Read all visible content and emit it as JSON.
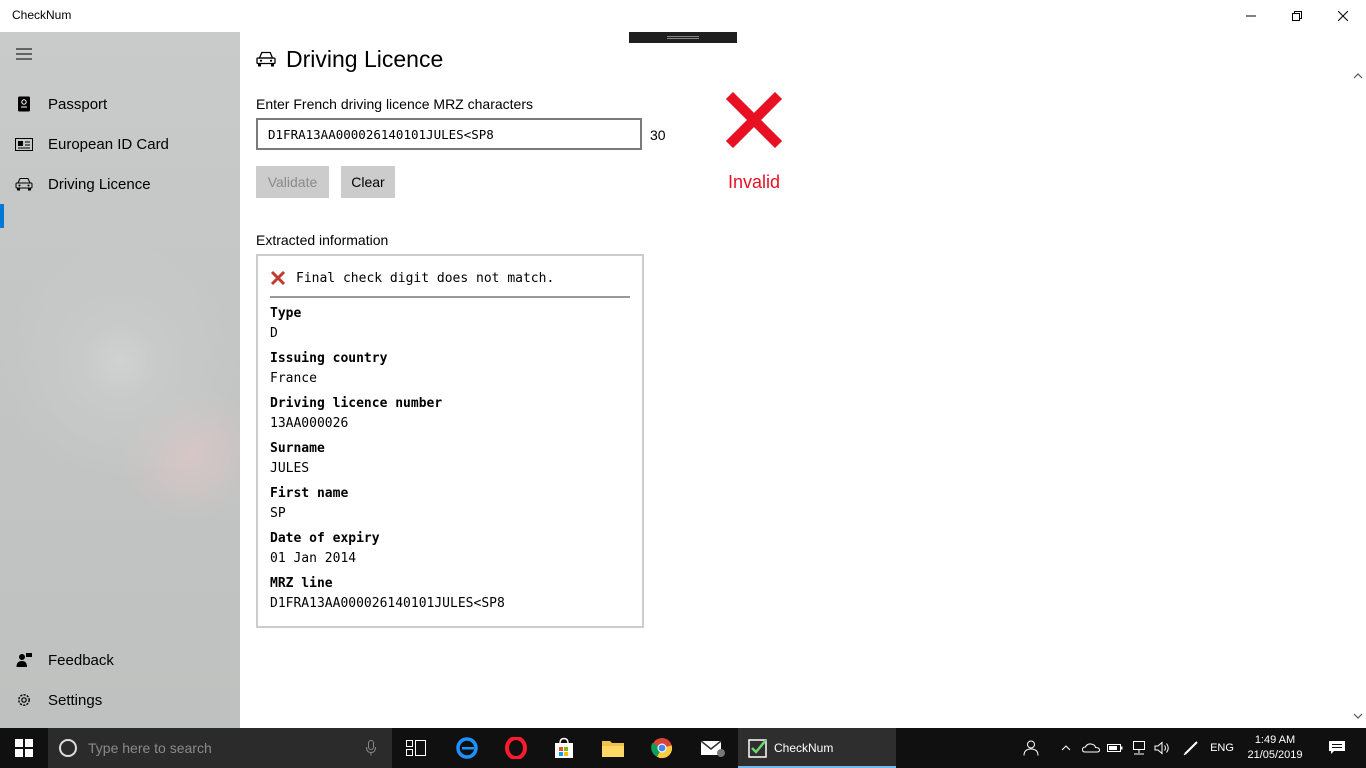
{
  "window": {
    "title": "CheckNum"
  },
  "sidebar": {
    "items": [
      {
        "label": "Passport",
        "icon": "passport-icon"
      },
      {
        "label": "European ID Card",
        "icon": "id-card-icon"
      },
      {
        "label": "Driving Licence",
        "icon": "car-icon",
        "selected": true
      }
    ],
    "footer": [
      {
        "label": "Feedback",
        "icon": "feedback-icon"
      },
      {
        "label": "Settings",
        "icon": "gear-icon"
      }
    ],
    "accent": "#0078d7"
  },
  "page": {
    "title": "Driving Licence",
    "input_label": "Enter French driving licence MRZ characters",
    "mrz_value": "D1FRA13AA000026140101JULES<SP8",
    "char_count": "30",
    "validate_label": "Validate",
    "clear_label": "Clear",
    "status": "Invalid",
    "status_color": "#e81123",
    "extracted_title": "Extracted information",
    "error_message": "Final check digit does not match.",
    "fields": [
      {
        "name": "Type",
        "value": "D"
      },
      {
        "name": "Issuing country",
        "value": "France"
      },
      {
        "name": "Driving licence number",
        "value": "13AA000026"
      },
      {
        "name": "Surname",
        "value": "JULES"
      },
      {
        "name": "First name",
        "value": "SP"
      },
      {
        "name": "Date of expiry",
        "value": "01 Jan 2014"
      },
      {
        "name": "MRZ line",
        "value": "D1FRA13AA000026140101JULES<SP8"
      }
    ]
  },
  "taskbar": {
    "search_placeholder": "Type here to search",
    "active_app": "CheckNum",
    "language": "ENG",
    "time": "1:49 AM",
    "date": "21/05/2019"
  }
}
